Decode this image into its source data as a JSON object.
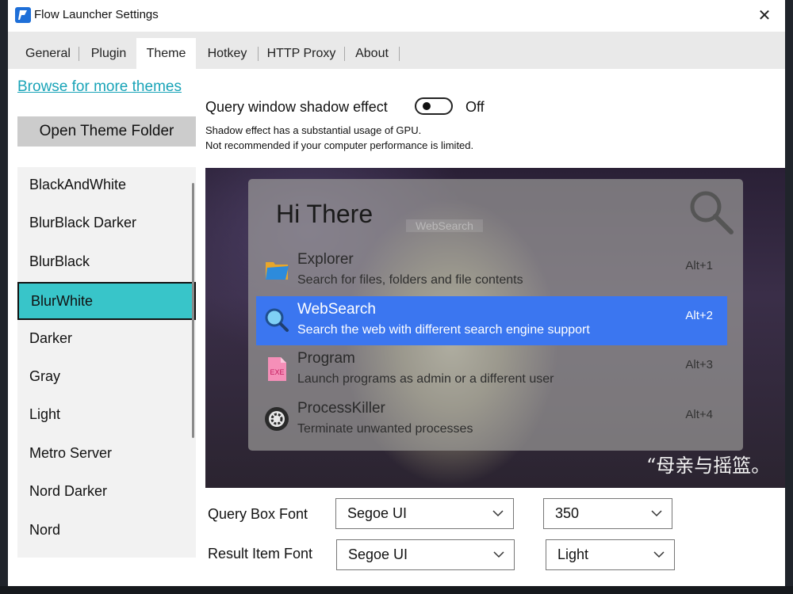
{
  "window": {
    "title": "Flow Launcher Settings",
    "close_glyph": "✕"
  },
  "tabs": [
    {
      "label": "General"
    },
    {
      "label": "Plugin"
    },
    {
      "label": "Theme"
    },
    {
      "label": "Hotkey"
    },
    {
      "label": "HTTP Proxy"
    },
    {
      "label": "About"
    }
  ],
  "active_tab": "Theme",
  "sidebar": {
    "browse_link": "Browse for more themes",
    "open_folder": "Open Theme Folder",
    "themes": [
      {
        "label": "BlackAndWhite"
      },
      {
        "label": "BlurBlack Darker"
      },
      {
        "label": "BlurBlack"
      },
      {
        "label": "BlurWhite"
      },
      {
        "label": "Darker"
      },
      {
        "label": "Gray"
      },
      {
        "label": "Light"
      },
      {
        "label": "Metro Server"
      },
      {
        "label": "Nord Darker"
      },
      {
        "label": "Nord"
      }
    ],
    "selected_theme": "BlurWhite"
  },
  "shadow": {
    "label": "Query window shadow effect",
    "state": "Off",
    "note_line1": "Shadow effect has a substantial usage of GPU.",
    "note_line2": "Not recommended if your computer performance is limited."
  },
  "preview": {
    "query": "Hi There",
    "ghost_text": "WebSearch",
    "caption": "“母亲与摇篮。",
    "results": [
      {
        "title": "Explorer",
        "subtitle": "Search for files, folders and file contents",
        "hotkey": "Alt+1",
        "icon": "folder-icon"
      },
      {
        "title": "WebSearch",
        "subtitle": "Search the web with different search engine support",
        "hotkey": "Alt+2",
        "icon": "search-icon"
      },
      {
        "title": "Program",
        "subtitle": "Launch programs as admin or a different user",
        "hotkey": "Alt+3",
        "icon": "exe-file-icon",
        "icon_text": "EXE"
      },
      {
        "title": "ProcessKiller",
        "subtitle": "Terminate unwanted processes",
        "hotkey": "Alt+4",
        "icon": "process-killer-icon"
      }
    ],
    "selected_index": 1
  },
  "fonts": {
    "query_label": "Query Box Font",
    "query_font": "Segoe UI",
    "query_weight": "350",
    "result_label": "Result Item Font",
    "result_font": "Segoe UI",
    "result_weight": "Light"
  },
  "colors": {
    "accent_selected_theme": "#38c5c9",
    "link": "#1aa4b8",
    "result_highlight": "#3b76f0"
  }
}
